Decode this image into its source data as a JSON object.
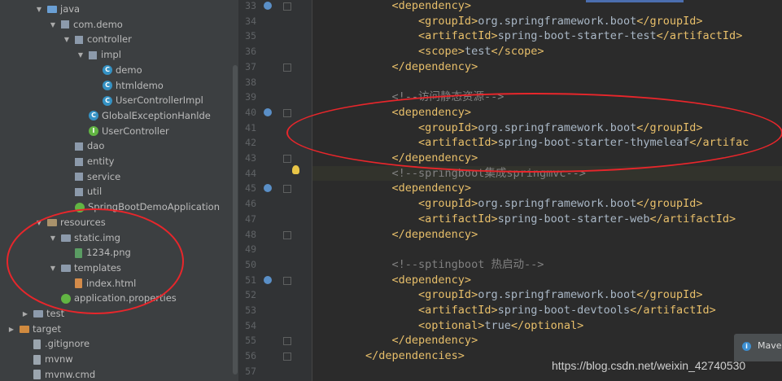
{
  "tree": [
    {
      "label": "java",
      "depth": 2,
      "icon": "folder-src",
      "expanded": true
    },
    {
      "label": "com.demo",
      "depth": 3,
      "icon": "package",
      "expanded": true
    },
    {
      "label": "controller",
      "depth": 4,
      "icon": "package",
      "expanded": true
    },
    {
      "label": "impl",
      "depth": 5,
      "icon": "package",
      "expanded": true
    },
    {
      "label": "demo",
      "depth": 6,
      "icon": "class"
    },
    {
      "label": "htmldemo",
      "depth": 6,
      "icon": "class"
    },
    {
      "label": "UserControllerImpl",
      "depth": 6,
      "icon": "class"
    },
    {
      "label": "GlobalExceptionHanlde",
      "depth": 5,
      "icon": "class"
    },
    {
      "label": "UserController",
      "depth": 5,
      "icon": "interface"
    },
    {
      "label": "dao",
      "depth": 4,
      "icon": "package"
    },
    {
      "label": "entity",
      "depth": 4,
      "icon": "package"
    },
    {
      "label": "service",
      "depth": 4,
      "icon": "package"
    },
    {
      "label": "util",
      "depth": 4,
      "icon": "package"
    },
    {
      "label": "SpringBootDemoApplication",
      "depth": 4,
      "icon": "spring"
    },
    {
      "label": "resources",
      "depth": 2,
      "icon": "folder-res",
      "expanded": true
    },
    {
      "label": "static.img",
      "depth": 3,
      "icon": "folder",
      "expanded": true
    },
    {
      "label": "1234.png",
      "depth": 4,
      "icon": "file-img"
    },
    {
      "label": "templates",
      "depth": 3,
      "icon": "folder",
      "expanded": true
    },
    {
      "label": "index.html",
      "depth": 4,
      "icon": "file-html"
    },
    {
      "label": "application.properties",
      "depth": 3,
      "icon": "spring"
    },
    {
      "label": "test",
      "depth": 1,
      "icon": "folder",
      "expanded": false
    },
    {
      "label": "target",
      "depth": 0,
      "icon": "folder-ex",
      "expanded": false
    },
    {
      "label": ".gitignore",
      "depth": 1,
      "icon": "file"
    },
    {
      "label": "mvnw",
      "depth": 1,
      "icon": "file"
    },
    {
      "label": "mvnw.cmd",
      "depth": 1,
      "icon": "file"
    }
  ],
  "lines": [
    {
      "n": "33",
      "segs": [
        [
          "tag",
          "            <dependency>"
        ]
      ],
      "gutter": "override"
    },
    {
      "n": "34",
      "segs": [
        [
          "tag",
          "                <groupId>"
        ],
        [
          "txt",
          "org.springframework.boot"
        ],
        [
          "tag",
          "</groupId>"
        ]
      ]
    },
    {
      "n": "35",
      "segs": [
        [
          "tag",
          "                <artifactId>"
        ],
        [
          "txt",
          "spring-boot-starter-test"
        ],
        [
          "tag",
          "</artifactId>"
        ]
      ]
    },
    {
      "n": "36",
      "segs": [
        [
          "tag",
          "                <scope>"
        ],
        [
          "txt",
          "test"
        ],
        [
          "tag",
          "</scope>"
        ]
      ]
    },
    {
      "n": "37",
      "segs": [
        [
          "tag",
          "            </dependency>"
        ]
      ],
      "fold": true
    },
    {
      "n": "38",
      "segs": []
    },
    {
      "n": "39",
      "segs": [
        [
          "cmt",
          "            <!--访问静态资源-->"
        ]
      ]
    },
    {
      "n": "40",
      "segs": [
        [
          "tag",
          "            <dependency>"
        ]
      ],
      "gutter": "override"
    },
    {
      "n": "41",
      "segs": [
        [
          "tag",
          "                <groupId>"
        ],
        [
          "txt",
          "org.springframework.boot"
        ],
        [
          "tag",
          "</groupId>"
        ]
      ]
    },
    {
      "n": "42",
      "segs": [
        [
          "tag",
          "                <artifactId>"
        ],
        [
          "txt",
          "spring-boot-starter-thymeleaf"
        ],
        [
          "tag",
          "</artifac"
        ]
      ]
    },
    {
      "n": "43",
      "segs": [
        [
          "tag",
          "            </dependency>"
        ]
      ],
      "fold": true
    },
    {
      "n": "44",
      "segs": [
        [
          "cmt",
          "            <!--springboot集成springmvc-->"
        ]
      ],
      "hl": true
    },
    {
      "n": "45",
      "segs": [
        [
          "tag",
          "            <dependency>"
        ]
      ],
      "gutter": "override"
    },
    {
      "n": "46",
      "segs": [
        [
          "tag",
          "                <groupId>"
        ],
        [
          "txt",
          "org.springframework.boot"
        ],
        [
          "tag",
          "</groupId>"
        ]
      ]
    },
    {
      "n": "47",
      "segs": [
        [
          "tag",
          "                <artifactId>"
        ],
        [
          "txt",
          "spring-boot-starter-web"
        ],
        [
          "tag",
          "</artifactId>"
        ]
      ]
    },
    {
      "n": "48",
      "segs": [
        [
          "tag",
          "            </dependency>"
        ]
      ],
      "fold": true
    },
    {
      "n": "49",
      "segs": []
    },
    {
      "n": "50",
      "segs": [
        [
          "cmt",
          "            <!--sptingboot 热启动-->"
        ]
      ]
    },
    {
      "n": "51",
      "segs": [
        [
          "tag",
          "            <dependency>"
        ]
      ],
      "gutter": "override"
    },
    {
      "n": "52",
      "segs": [
        [
          "tag",
          "                <groupId>"
        ],
        [
          "txt",
          "org.springframework.boot"
        ],
        [
          "tag",
          "</groupId>"
        ]
      ]
    },
    {
      "n": "53",
      "segs": [
        [
          "tag",
          "                <artifactId>"
        ],
        [
          "txt",
          "spring-boot-devtools"
        ],
        [
          "tag",
          "</artifactId>"
        ]
      ]
    },
    {
      "n": "54",
      "segs": [
        [
          "tag",
          "                <optional>"
        ],
        [
          "txt",
          "true"
        ],
        [
          "tag",
          "</optional>"
        ]
      ]
    },
    {
      "n": "55",
      "segs": [
        [
          "tag",
          "            </dependency>"
        ]
      ],
      "fold": true
    },
    {
      "n": "56",
      "segs": [
        [
          "tag",
          "        </dependencies>"
        ]
      ],
      "fold": true
    },
    {
      "n": "57",
      "segs": []
    }
  ],
  "notification": {
    "label": "Mave"
  },
  "watermark": "https://blog.csdn.net/weixin_42740530",
  "colors": {
    "annotation": "#e8262b",
    "tag": "#e8bf6a",
    "comment": "#808080",
    "text": "#a9b7c6"
  }
}
